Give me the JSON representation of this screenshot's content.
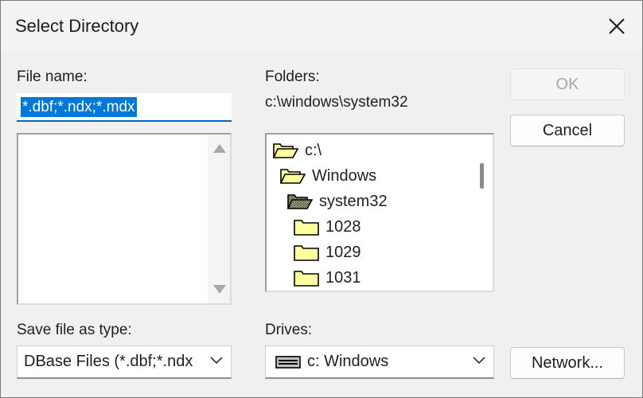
{
  "window": {
    "title": "Select Directory"
  },
  "file_name": {
    "label": "File name:",
    "value": "*.dbf;*.ndx;*.mdx"
  },
  "folders": {
    "label": "Folders:",
    "current_path": "c:\\windows\\system32",
    "tree": [
      {
        "name": "c:\\",
        "icon": "open-folder-icon"
      },
      {
        "name": "Windows",
        "icon": "open-folder-icon"
      },
      {
        "name": "system32",
        "icon": "open-folder-selected-icon"
      },
      {
        "name": "1028",
        "icon": "folder-icon"
      },
      {
        "name": "1029",
        "icon": "folder-icon"
      },
      {
        "name": "1031",
        "icon": "folder-icon"
      }
    ]
  },
  "save_type": {
    "label": "Save file as type:",
    "value": "DBase Files (*.dbf;*.ndx"
  },
  "drives": {
    "label": "Drives:",
    "value": "c: Windows",
    "icon": "drive-icon"
  },
  "buttons": {
    "ok": "OK",
    "cancel": "Cancel",
    "network": "Network..."
  },
  "colors": {
    "selection": "#0078d7",
    "folder_fill": "#ffffa0",
    "accent_underline": "#0067c0"
  }
}
